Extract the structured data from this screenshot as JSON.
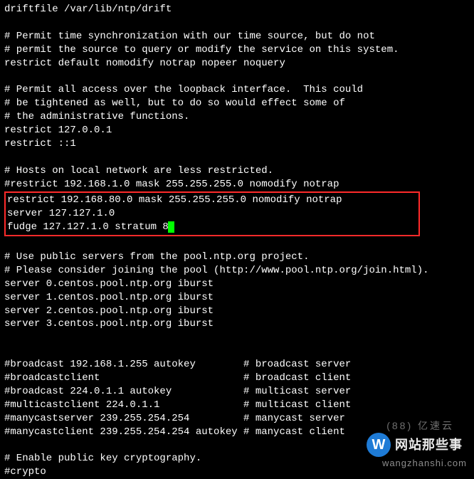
{
  "config": {
    "lines_before": [
      "driftfile /var/lib/ntp/drift",
      "",
      "# Permit time synchronization with our time source, but do not",
      "# permit the source to query or modify the service on this system.",
      "restrict default nomodify notrap nopeer noquery",
      "",
      "# Permit all access over the loopback interface.  This could",
      "# be tightened as well, but to do so would effect some of",
      "# the administrative functions.",
      "restrict 127.0.0.1",
      "restrict ::1",
      "",
      "# Hosts on local network are less restricted.",
      "#restrict 192.168.1.0 mask 255.255.255.0 nomodify notrap"
    ],
    "highlight": [
      "restrict 192.168.80.0 mask 255.255.255.0 nomodify notrap",
      "server 127.127.1.0",
      "fudge 127.127.1.0 stratum 8"
    ],
    "lines_after": [
      "",
      "# Use public servers from the pool.ntp.org project.",
      "# Please consider joining the pool (http://www.pool.ntp.org/join.html).",
      "server 0.centos.pool.ntp.org iburst",
      "server 1.centos.pool.ntp.org iburst",
      "server 2.centos.pool.ntp.org iburst",
      "server 3.centos.pool.ntp.org iburst",
      "",
      "",
      "#broadcast 192.168.1.255 autokey        # broadcast server",
      "#broadcastclient                        # broadcast client",
      "#broadcast 224.0.1.1 autokey            # multicast server",
      "#multicastclient 224.0.1.1              # multicast client",
      "#manycastserver 239.255.254.254         # manycast server",
      "#manycastclient 239.255.254.254 autokey # manycast client",
      "",
      "# Enable public key cryptography.",
      "#crypto"
    ]
  },
  "watermarks": {
    "yiyiyun": "(88) 亿速云",
    "url": "wangzhanshi.com",
    "brand_letter": "W",
    "brand_text": "网站那些事"
  }
}
